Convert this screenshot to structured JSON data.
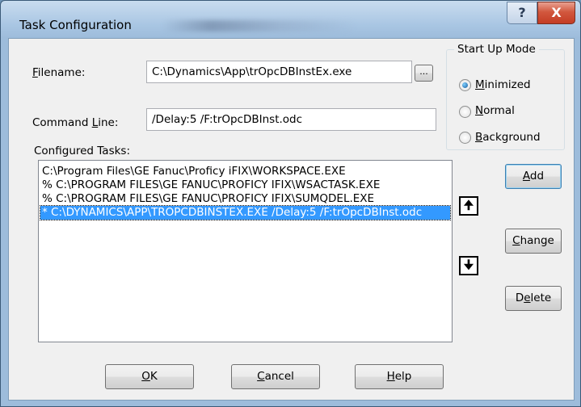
{
  "window": {
    "title": "Task Configuration",
    "help_glyph": "?",
    "close_glyph": "X"
  },
  "filename": {
    "label": "Filename:",
    "value": "C:\\Dynamics\\App\\trOpcDBInstEx.exe",
    "browse_label": "..."
  },
  "command_line": {
    "label": "Command Line:",
    "value": "/Delay:5 /F:trOpcDBInst.odc"
  },
  "startup_mode": {
    "title": "Start Up Mode",
    "options": [
      {
        "label": "Minimized",
        "checked": true
      },
      {
        "label": "Normal",
        "checked": false
      },
      {
        "label": "Background",
        "checked": false
      }
    ]
  },
  "tasks": {
    "label": "Configured Tasks:",
    "items": [
      {
        "text": "  C:\\Program Files\\GE Fanuc\\Proficy iFIX\\WORKSPACE.EXE",
        "selected": false
      },
      {
        "text": "% C:\\PROGRAM FILES\\GE FANUC\\PROFICY IFIX\\WSACTASK.EXE",
        "selected": false
      },
      {
        "text": "% C:\\PROGRAM FILES\\GE FANUC\\PROFICY IFIX\\SUMQDEL.EXE",
        "selected": false
      },
      {
        "text": "* C:\\DYNAMICS\\APP\\TROPCDBINSTEX.EXE  /Delay:5 /F:trOpcDBInst.odc",
        "selected": true
      }
    ]
  },
  "side_buttons": {
    "add": "Add",
    "change": "Change",
    "delete": "Delete",
    "up_glyph": "🠉",
    "down_glyph": "🠋"
  },
  "footer": {
    "ok": "OK",
    "cancel": "Cancel",
    "help": "Help"
  },
  "colors": {
    "selection": "#3399ff",
    "close_button": "#c43c24",
    "title_bar": "#a9c6e3"
  }
}
